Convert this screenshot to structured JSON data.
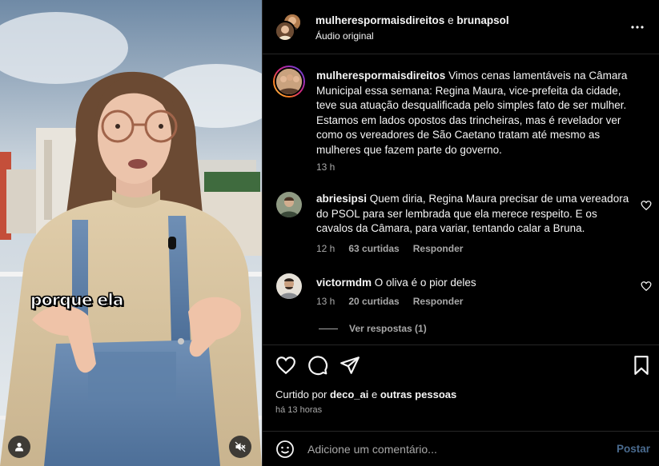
{
  "media": {
    "caption_sticker": "porque ela"
  },
  "header": {
    "author1": "mulherespormaisdireitos",
    "connector": "e",
    "author2": "brunapsol",
    "audio": "Áudio original",
    "more_icon": "more-horizontal-icon"
  },
  "post": {
    "username": "mulherespormaisdireitos",
    "caption": "Vimos cenas lamentáveis na Câmara Municipal essa semana: Regina Maura, vice-prefeita da cidade, teve sua atuação desqualificada pelo simples fato de ser mulher. Estamos em lados opostos das trincheiras, mas é revelador ver como os vereadores de São Caetano tratam até mesmo as mulheres que fazem parte do governo.",
    "time": "13 h"
  },
  "comments": [
    {
      "username": "abriesipsi",
      "text": "Quem diria, Regina Maura precisar de uma vereadora do PSOL para ser lembrada que ela merece respeito. E os cavalos da Câmara, para variar, tentando calar a Bruna.",
      "time": "12 h",
      "likes": "63 curtidas",
      "reply": "Responder"
    },
    {
      "username": "victormdm",
      "text": "O oliva é o pior deles",
      "time": "13 h",
      "likes": "20 curtidas",
      "reply": "Responder"
    }
  ],
  "view_replies": "Ver respostas (1)",
  "likes": {
    "prefix": "Curtido por",
    "user": "deco_ai",
    "connector": "e",
    "others": "outras pessoas"
  },
  "posted_ago": "há 13 horas",
  "add_comment": {
    "placeholder": "Adicione um comentário...",
    "post_label": "Postar"
  },
  "colors": {
    "background": "#000000",
    "muted_text": "#a8a8a8",
    "post_button": "#4a6b8f"
  }
}
